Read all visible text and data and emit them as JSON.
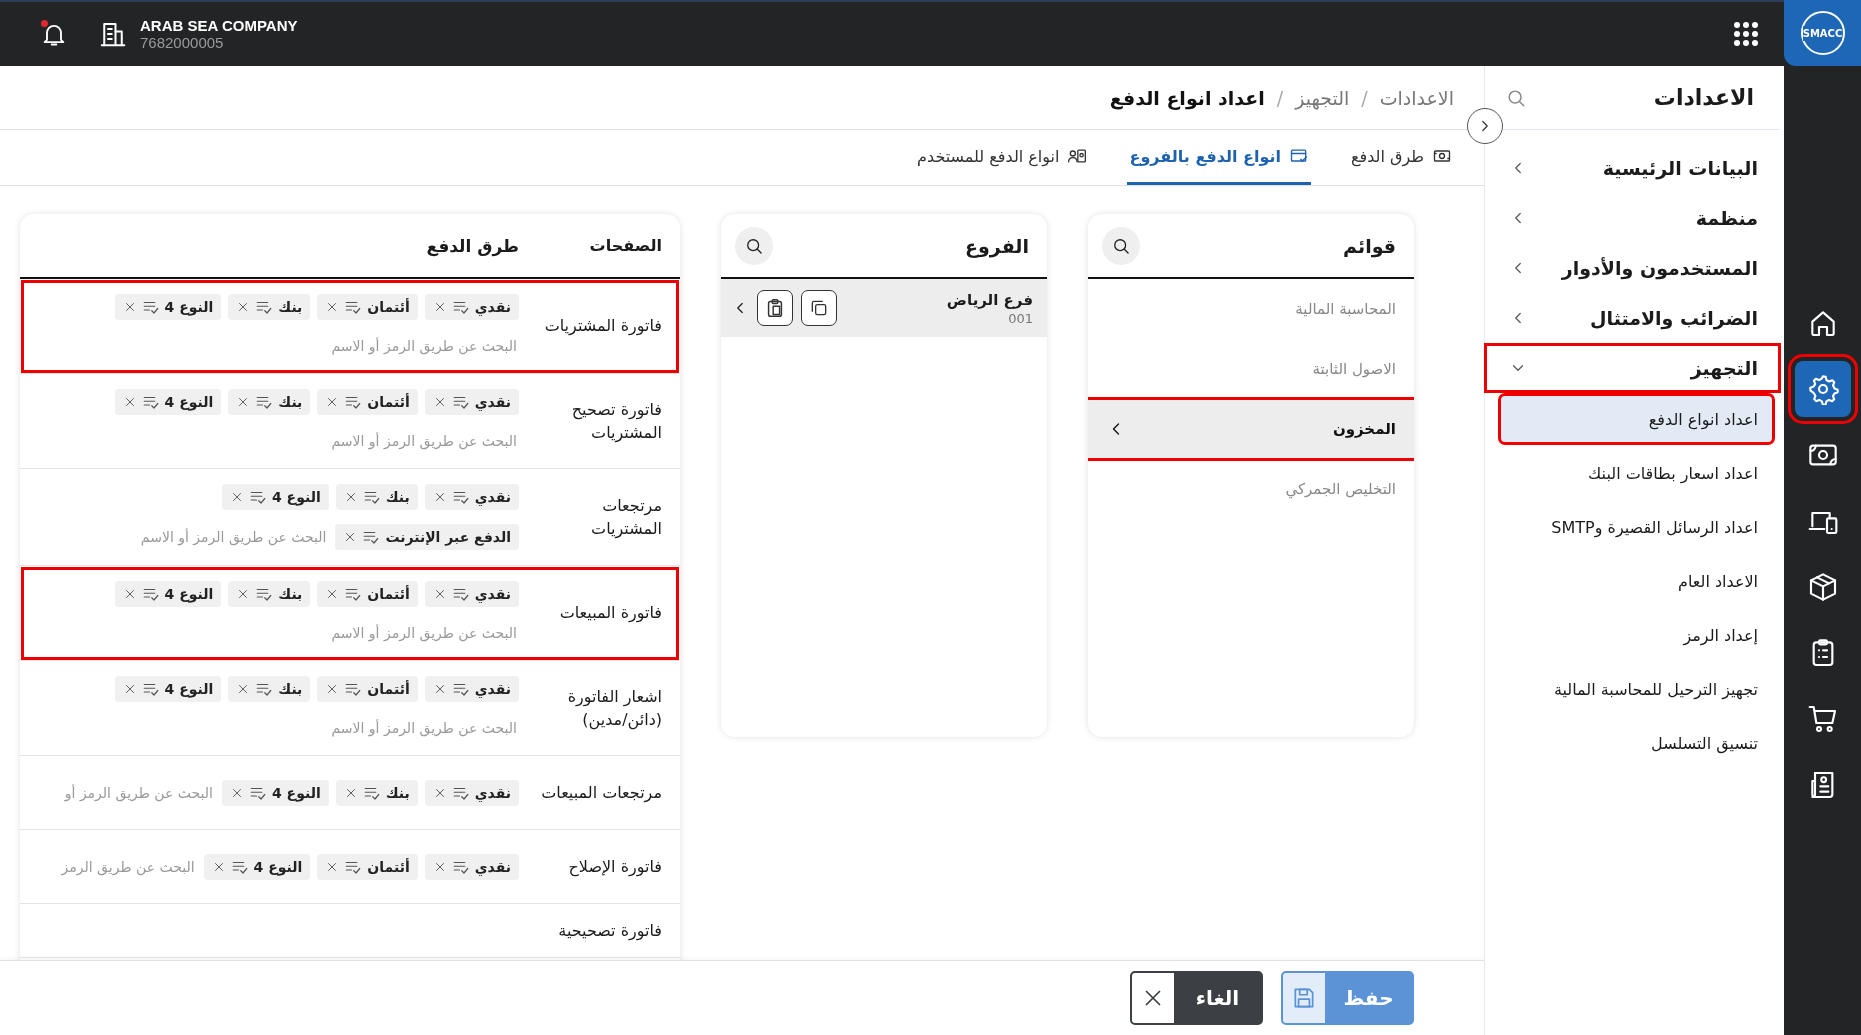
{
  "topbar": {
    "company": "ARAB SEA COMPANY",
    "company_id": "7682000005",
    "notification_dot": true,
    "logo": "SMACC"
  },
  "rail": [
    {
      "kind": "home",
      "selected": false,
      "highlighted": false
    },
    {
      "kind": "gear",
      "selected": true,
      "highlighted": true
    },
    {
      "kind": "money",
      "selected": false,
      "highlighted": false
    },
    {
      "kind": "devices",
      "selected": false,
      "highlighted": false
    },
    {
      "kind": "box",
      "selected": false,
      "highlighted": false
    },
    {
      "kind": "clipboard",
      "selected": false,
      "highlighted": false
    },
    {
      "kind": "cart",
      "selected": false,
      "highlighted": false
    },
    {
      "kind": "document",
      "selected": false,
      "highlighted": false
    }
  ],
  "settings": {
    "title": "الاعدادات",
    "groups": [
      {
        "label": "البيانات الرئيسية",
        "expanded": false,
        "highlighted": false
      },
      {
        "label": "منظمة",
        "expanded": false,
        "highlighted": false
      },
      {
        "label": "المستخدمون والأدوار",
        "expanded": false,
        "highlighted": false
      },
      {
        "label": "الضرائب والامتثال",
        "expanded": false,
        "highlighted": false
      },
      {
        "label": "التجهيز",
        "expanded": true,
        "highlighted": true,
        "children": [
          {
            "label": "اعداد انواع الدفع",
            "selected": true,
            "highlighted": true
          },
          {
            "label": "اعداد اسعار بطاقات البنك",
            "selected": false,
            "highlighted": false
          },
          {
            "label": "اعداد الرسائل القصيرة وSMTP",
            "selected": false,
            "highlighted": false
          },
          {
            "label": "الاعداد العام",
            "selected": false,
            "highlighted": false
          },
          {
            "label": "إعداد الرمز",
            "selected": false,
            "highlighted": false
          },
          {
            "label": "تجهيز الترحيل للمحاسبة المالية",
            "selected": false,
            "highlighted": false
          },
          {
            "label": "تنسيق التسلسل",
            "selected": false,
            "highlighted": false
          }
        ]
      }
    ]
  },
  "breadcrumb": {
    "items": [
      "الاعدادات",
      "التجهيز",
      "اعداد انواع الدفع"
    ],
    "separator": "/"
  },
  "tabs": [
    {
      "label": "طرق الدفع",
      "kind": "money",
      "selected": false
    },
    {
      "label": "انواع الدفع بالفروع",
      "kind": "card",
      "selected": true
    },
    {
      "label": "انواع الدفع للمستخدم",
      "kind": "user",
      "selected": false
    }
  ],
  "lists": {
    "title": "قوائم",
    "items": [
      {
        "label": "المحاسبة المالية",
        "selected": false,
        "highlighted": false
      },
      {
        "label": "الاصول الثابتة",
        "selected": false,
        "highlighted": false
      },
      {
        "label": "المخزون",
        "selected": true,
        "highlighted": true
      },
      {
        "label": "التخليص الجمركي",
        "selected": false,
        "highlighted": false
      }
    ]
  },
  "branches": {
    "title": "الفروع",
    "items": [
      {
        "name": "فرع الرياض",
        "code": "001",
        "selected": true
      }
    ]
  },
  "table": {
    "columns": [
      "الصفحات",
      "طرق الدفع"
    ],
    "rows": [
      {
        "page": "فاتورة المشتريات",
        "highlighted": true,
        "methods": [
          "نقدي",
          "أئتمان",
          "بنك",
          "النوع 4"
        ],
        "placeholder": "البحث عن طريق الرمز أو الاسم"
      },
      {
        "page": "فاتورة تصحيح المشتريات",
        "highlighted": false,
        "methods": [
          "نقدي",
          "أئتمان",
          "بنك",
          "النوع 4"
        ],
        "placeholder": "البحث عن طريق الرمز أو الاسم"
      },
      {
        "page": "مرتجعات المشتريات",
        "highlighted": false,
        "methods": [
          "نقدي",
          "بنك",
          "النوع 4",
          "الدفع عبر الإنترنت"
        ],
        "placeholder": "البحث عن طريق الرمز أو الاسم"
      },
      {
        "page": "فاتورة المبيعات",
        "highlighted": true,
        "methods": [
          "نقدي",
          "أئتمان",
          "بنك",
          "النوع 4"
        ],
        "placeholder": "البحث عن طريق الرمز أو الاسم"
      },
      {
        "page": "اشعار الفاتورة (دائن/مدين)",
        "highlighted": false,
        "methods": [
          "نقدي",
          "أئتمان",
          "بنك",
          "النوع 4"
        ],
        "placeholder": "البحث عن طريق الرمز أو الاسم"
      },
      {
        "page": "مرتجعات المبيعات",
        "highlighted": false,
        "methods": [
          "نقدي",
          "بنك",
          "النوع 4"
        ],
        "placeholder": "البحث عن طريق الرمز أو"
      },
      {
        "page": "فاتورة الإصلاح",
        "highlighted": false,
        "methods": [
          "نقدي",
          "أئتمان",
          "النوع 4"
        ],
        "placeholder": "البحث عن طريق الرمز"
      },
      {
        "page": "فاتورة تصحيحية",
        "highlighted": false,
        "methods": []
      }
    ]
  },
  "buttons": [
    {
      "label": "حفظ",
      "kind": "save"
    },
    {
      "label": "الغاء",
      "kind": "cancel"
    }
  ]
}
